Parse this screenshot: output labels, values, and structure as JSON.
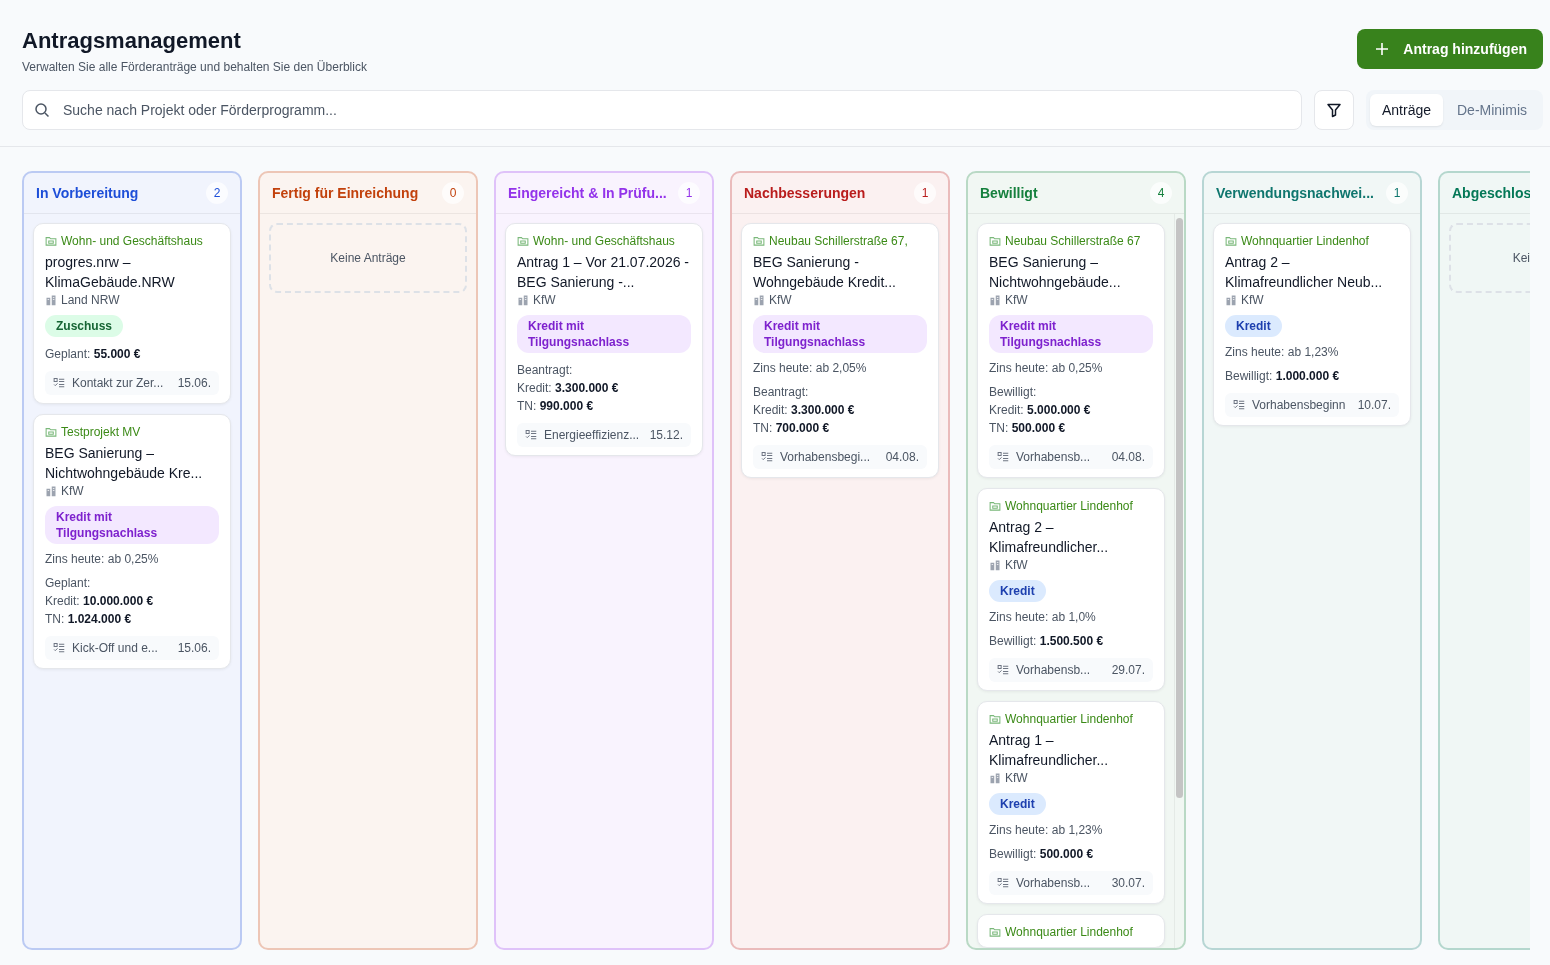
{
  "header": {
    "title": "Antragsmanagement",
    "subtitle": "Verwalten Sie alle Förderanträge und behalten Sie den Überblick",
    "add_button": "Antrag hinzufügen"
  },
  "search": {
    "placeholder": "Suche nach Projekt oder Förderprogramm..."
  },
  "view_tabs": [
    {
      "label": "Anträge",
      "selected": true
    },
    {
      "label": "De-Minimis",
      "selected": false
    }
  ],
  "columns": [
    {
      "title": "In Vorbereitung",
      "count": "2",
      "color": "#1d4ed8",
      "scrollbar": false,
      "cards": [
        {
          "project": "Wohn- und Geschäftshaus",
          "title": "progres.nrw – KlimaGebäude.NRW",
          "funder": "Land NRW",
          "tag": {
            "kind": "grant",
            "label": "Zuschuss"
          },
          "amount": {
            "label": "Geplant:",
            "value": "55.000 €"
          },
          "task": "Kontakt zur Zer...",
          "date": "15.06."
        },
        {
          "project": "Testprojekt MV",
          "title": "BEG Sanierung – Nichtwohngebäude Kre...",
          "funder": "KfW",
          "tag": {
            "kind": "repayment",
            "label": "Kredit mit Tilgungsnachlass"
          },
          "rate": "Zins heute: ab 0,25%",
          "amount": {
            "label": "Geplant:",
            "lines": [
              {
                "label": "Kredit:",
                "value": "10.000.000 €"
              },
              {
                "label": "TN:",
                "value": "1.024.000 €"
              }
            ]
          },
          "task": "Kick-Off und e...",
          "date": "15.06."
        }
      ]
    },
    {
      "title": "Fertig für Einreichung",
      "count": "0",
      "color": "#c2410c",
      "scrollbar": false,
      "empty": "Keine Anträge"
    },
    {
      "title": "Eingereicht & In Prüfu...",
      "count": "1",
      "color": "#9333ea",
      "scrollbar": false,
      "cards": [
        {
          "project": "Wohn- und Geschäftshaus",
          "title": "Antrag 1 – Vor 21.07.2026 - BEG Sanierung -...",
          "funder": "KfW",
          "tag": {
            "kind": "repayment",
            "label": "Kredit mit Tilgungsnachlass"
          },
          "amount": {
            "label": "Beantragt:",
            "lines": [
              {
                "label": "Kredit:",
                "value": "3.300.000 €"
              },
              {
                "label": "TN:",
                "value": "990.000 €"
              }
            ]
          },
          "task": "Energieeffizienz...",
          "date": "15.12."
        }
      ]
    },
    {
      "title": "Nachbesserungen",
      "count": "1",
      "color": "#b91c1c",
      "scrollbar": false,
      "cards": [
        {
          "project": "Neubau Schillerstraße 67,",
          "title": "BEG Sanierung - Wohngebäude Kredit...",
          "funder": "KfW",
          "tag": {
            "kind": "repayment",
            "label": "Kredit mit Tilgungsnachlass"
          },
          "rate": "Zins heute: ab 2,05%",
          "amount": {
            "label": "Beantragt:",
            "lines": [
              {
                "label": "Kredit:",
                "value": "3.300.000 €"
              },
              {
                "label": "TN:",
                "value": "700.000 €"
              }
            ]
          },
          "task": "Vorhabensbegi...",
          "date": "04.08."
        }
      ]
    },
    {
      "title": "Bewilligt",
      "count": "4",
      "color": "#15803d",
      "scrollbar": true,
      "cards": [
        {
          "project": "Neubau Schillerstraße 67",
          "title": "BEG Sanierung – Nichtwohngebäude...",
          "funder": "KfW",
          "tag": {
            "kind": "repayment",
            "label": "Kredit mit Tilgungsnachlass"
          },
          "rate": "Zins heute: ab 0,25%",
          "amount": {
            "label": "Bewilligt:",
            "lines": [
              {
                "label": "Kredit:",
                "value": "5.000.000 €"
              },
              {
                "label": "TN:",
                "value": "500.000 €"
              }
            ]
          },
          "task": "Vorhabensb...",
          "date": "04.08."
        },
        {
          "project": "Wohnquartier Lindenhof",
          "title": "Antrag 2 – Klimafreundlicher...",
          "funder": "KfW",
          "tag": {
            "kind": "loan",
            "label": "Kredit"
          },
          "rate": "Zins heute: ab 1,0%",
          "amount": {
            "label": "Bewilligt:",
            "value": "1.500.500 €"
          },
          "task": "Vorhabensb...",
          "date": "29.07."
        },
        {
          "project": "Wohnquartier Lindenhof",
          "title": "Antrag 1 – Klimafreundlicher...",
          "funder": "KfW",
          "tag": {
            "kind": "loan",
            "label": "Kredit"
          },
          "rate": "Zins heute: ab 1,23%",
          "amount": {
            "label": "Bewilligt:",
            "value": "500.000 €"
          },
          "task": "Vorhabensb...",
          "date": "30.07."
        },
        {
          "project": "Wohnquartier Lindenhof"
        }
      ]
    },
    {
      "title": "Verwendungsnachwei...",
      "count": "1",
      "color": "#0f766e",
      "scrollbar": false,
      "cards": [
        {
          "project": "Wohnquartier Lindenhof",
          "title": "Antrag 2 – Klimafreundlicher Neub...",
          "funder": "KfW",
          "tag": {
            "kind": "loan",
            "label": "Kredit"
          },
          "rate": "Zins heute: ab 1,23%",
          "amount": {
            "label": "Bewilligt:",
            "value": "1.000.000 €"
          },
          "task": "Vorhabensbeginn",
          "date": "10.07."
        }
      ]
    },
    {
      "title": "Abgeschlos",
      "color": "#047857",
      "scrollbar": false,
      "empty": "Kei"
    }
  ]
}
